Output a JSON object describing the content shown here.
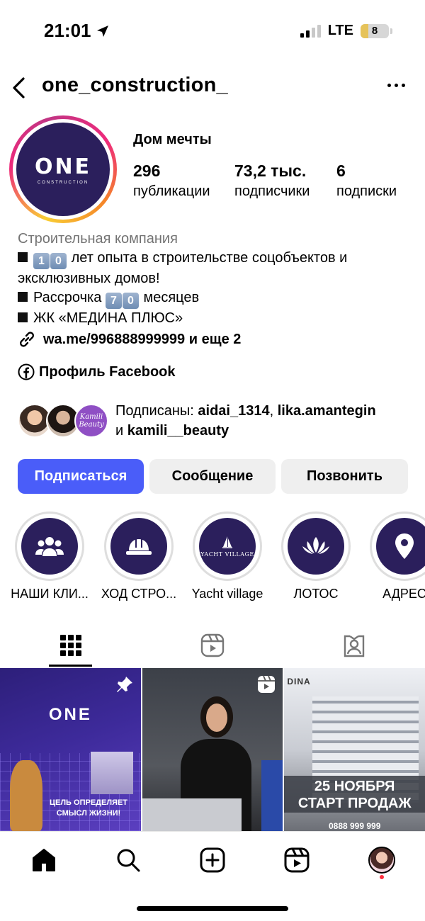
{
  "status_bar": {
    "time": "21:01",
    "network": "LTE",
    "battery": "8"
  },
  "header": {
    "username": "one_construction_"
  },
  "profile": {
    "avatar_logo": "ONE",
    "avatar_logo_sub": "CONSTRUCTION",
    "name": "Дом мечты",
    "stats": [
      {
        "value": "296",
        "label": "публикации"
      },
      {
        "value": "73,2 тыс.",
        "label": "подписчики"
      },
      {
        "value": "6",
        "label": "подписки"
      }
    ]
  },
  "bio": {
    "category": "Строительная компания",
    "line1_key_a": "1",
    "line1_key_b": "0",
    "line1_text": "лет опыта в строительстве соцобъектов и",
    "line2_text": "эксклюзивных домов!",
    "line3_prefix": "Рассрочка",
    "line3_key_a": "7",
    "line3_key_b": "0",
    "line3_suffix": "месяцев",
    "line4_text": "ЖК «МЕДИНА ПЛЮС»"
  },
  "link": {
    "text": "wa.me/996888999999 и еще 2"
  },
  "facebook": {
    "text": "Профиль Facebook"
  },
  "followed_by": {
    "prefix": "Подписаны:",
    "user1": "aidai_1314",
    "user2": "lika.amantegin",
    "conj": "и",
    "user3": "kamili__beauty",
    "avatar3_text": "Kamili Beauty"
  },
  "buttons": {
    "follow": "Подписаться",
    "message": "Сообщение",
    "call": "Позвонить"
  },
  "highlights": [
    {
      "label": "НАШИ КЛИ...",
      "icon": "people-icon"
    },
    {
      "label": "ХОД СТРО...",
      "icon": "hard-hat-icon"
    },
    {
      "label": "Yacht village",
      "icon": "sailboat-icon",
      "logo_text": "YACHT VILLAGE"
    },
    {
      "label": "ЛОТОС",
      "icon": "lotus-icon"
    },
    {
      "label": "АДРЕС",
      "icon": "location-pin-icon"
    }
  ],
  "tabs": [
    {
      "name": "grid",
      "icon": "grid-icon",
      "active": true
    },
    {
      "name": "reels",
      "icon": "reels-icon",
      "active": false
    },
    {
      "name": "tagged",
      "icon": "tagged-icon",
      "active": false
    }
  ],
  "posts": [
    {
      "logo": "ONE",
      "caption": "ЦЕЛЬ ОПРЕДЕЛЯЕТ СМЫСЛ ЖИЗНИ!",
      "badge": "pin-icon"
    },
    {
      "badge": "reels-icon"
    },
    {
      "brand": "DINA",
      "banner_line1": "25 НОЯБРЯ",
      "banner_line2": "СТАРТ ПРОДАЖ",
      "phone": "0888 999 999"
    }
  ],
  "bottom_nav": [
    "home-icon",
    "search-icon",
    "create-icon",
    "reels-icon",
    "profile-avatar"
  ],
  "colors": {
    "follow_button": "#4a5df9",
    "avatar_bg": "#2b1f5c",
    "secondary_button": "#efefef",
    "category_text": "#737373"
  }
}
